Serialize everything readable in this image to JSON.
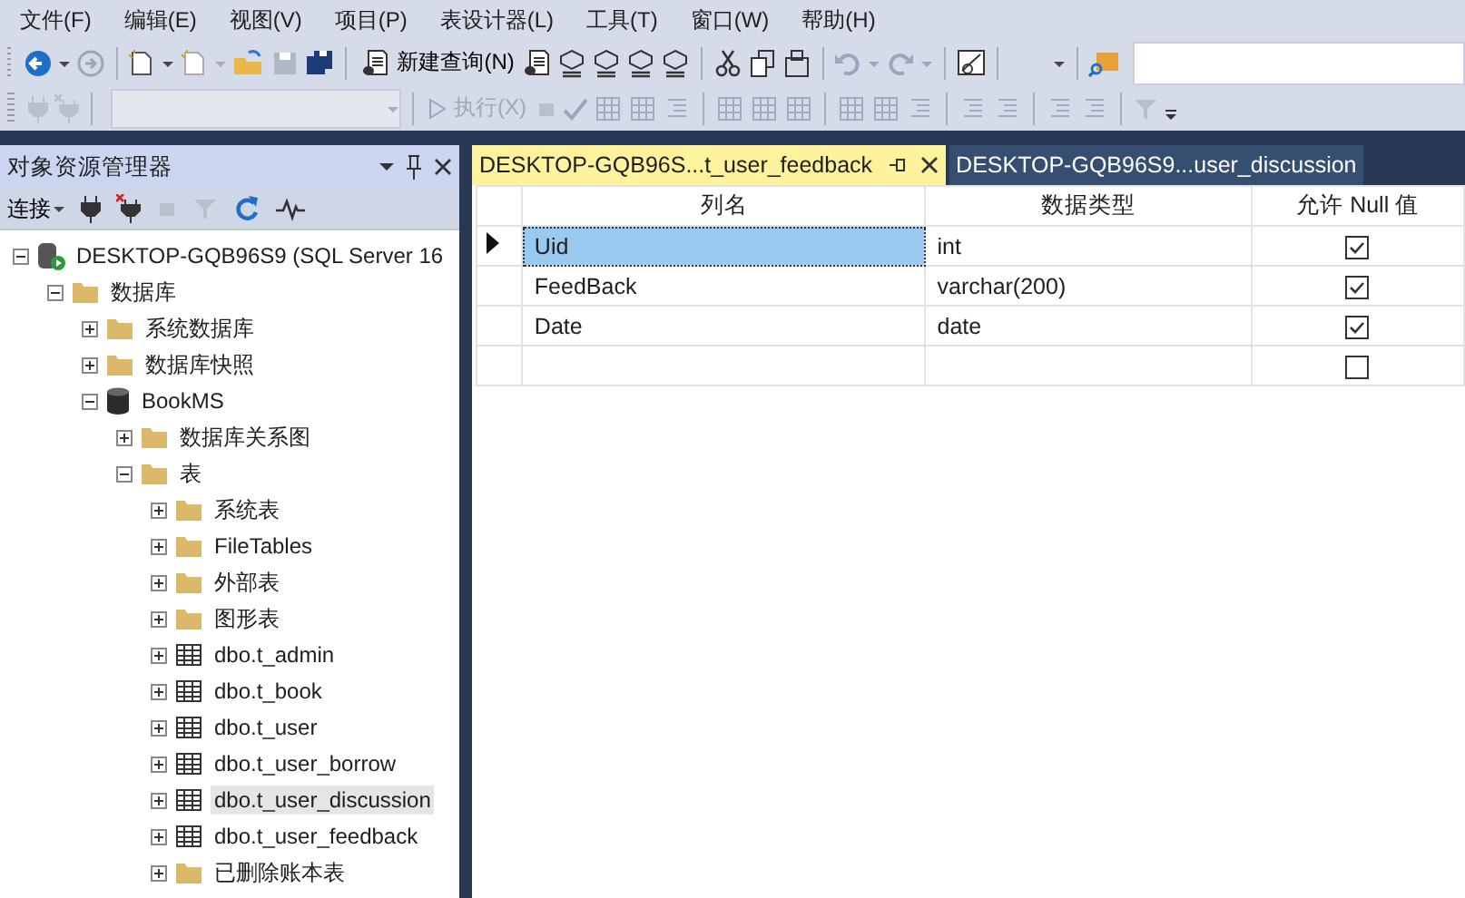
{
  "menu": [
    "文件(F)",
    "编辑(E)",
    "视图(V)",
    "项目(P)",
    "表设计器(L)",
    "工具(T)",
    "窗口(W)",
    "帮助(H)"
  ],
  "toolbar": {
    "new_query": "新建查询(N)",
    "execute": {
      "label": "执行(X)",
      "disabled": true
    }
  },
  "object_explorer": {
    "title": "对象资源管理器",
    "connect": "连接",
    "tree": [
      {
        "label": "DESKTOP-GQB96S9 (SQL Server 16",
        "kind": "server",
        "expanded": true,
        "selected": false,
        "children": [
          {
            "label": "数据库",
            "kind": "folder",
            "expanded": true,
            "selected": false,
            "children": [
              {
                "label": "系统数据库",
                "kind": "folder",
                "expanded": false,
                "selected": false
              },
              {
                "label": "数据库快照",
                "kind": "folder",
                "expanded": false,
                "selected": false
              },
              {
                "label": "BookMS",
                "kind": "database",
                "expanded": true,
                "selected": false,
                "children": [
                  {
                    "label": "数据库关系图",
                    "kind": "folder",
                    "expanded": false,
                    "selected": false
                  },
                  {
                    "label": "表",
                    "kind": "folder",
                    "expanded": true,
                    "selected": false,
                    "children": [
                      {
                        "label": "系统表",
                        "kind": "folder",
                        "expanded": false,
                        "selected": false
                      },
                      {
                        "label": "FileTables",
                        "kind": "folder",
                        "expanded": false,
                        "selected": false
                      },
                      {
                        "label": "外部表",
                        "kind": "folder",
                        "expanded": false,
                        "selected": false
                      },
                      {
                        "label": "图形表",
                        "kind": "folder",
                        "expanded": false,
                        "selected": false
                      },
                      {
                        "label": "dbo.t_admin",
                        "kind": "table",
                        "expanded": false,
                        "selected": false
                      },
                      {
                        "label": "dbo.t_book",
                        "kind": "table",
                        "expanded": false,
                        "selected": false
                      },
                      {
                        "label": "dbo.t_user",
                        "kind": "table",
                        "expanded": false,
                        "selected": false
                      },
                      {
                        "label": "dbo.t_user_borrow",
                        "kind": "table",
                        "expanded": false,
                        "selected": false
                      },
                      {
                        "label": "dbo.t_user_discussion",
                        "kind": "table",
                        "expanded": false,
                        "selected": true
                      },
                      {
                        "label": "dbo.t_user_feedback",
                        "kind": "table",
                        "expanded": false,
                        "selected": false
                      },
                      {
                        "label": "已删除账本表",
                        "kind": "folder",
                        "expanded": false,
                        "selected": false
                      }
                    ]
                  }
                ]
              }
            ]
          }
        ]
      }
    ]
  },
  "tabs": [
    {
      "label": "DESKTOP-GQB96S...t_user_feedback",
      "selected": true
    },
    {
      "label": "DESKTOP-GQB96S9...user_discussion",
      "selected": false
    }
  ],
  "table": {
    "columns": [
      "列名",
      "数据类型",
      "允许 Null 值"
    ],
    "rows": [
      {
        "name": "Uid",
        "type": "int",
        "allow_null": true,
        "selected": true
      },
      {
        "name": "FeedBack",
        "type": "varchar(200)",
        "allow_null": true,
        "selected": false
      },
      {
        "name": "Date",
        "type": "date",
        "allow_null": true,
        "selected": false
      },
      {
        "allow_null": false,
        "selected": false
      }
    ]
  }
}
